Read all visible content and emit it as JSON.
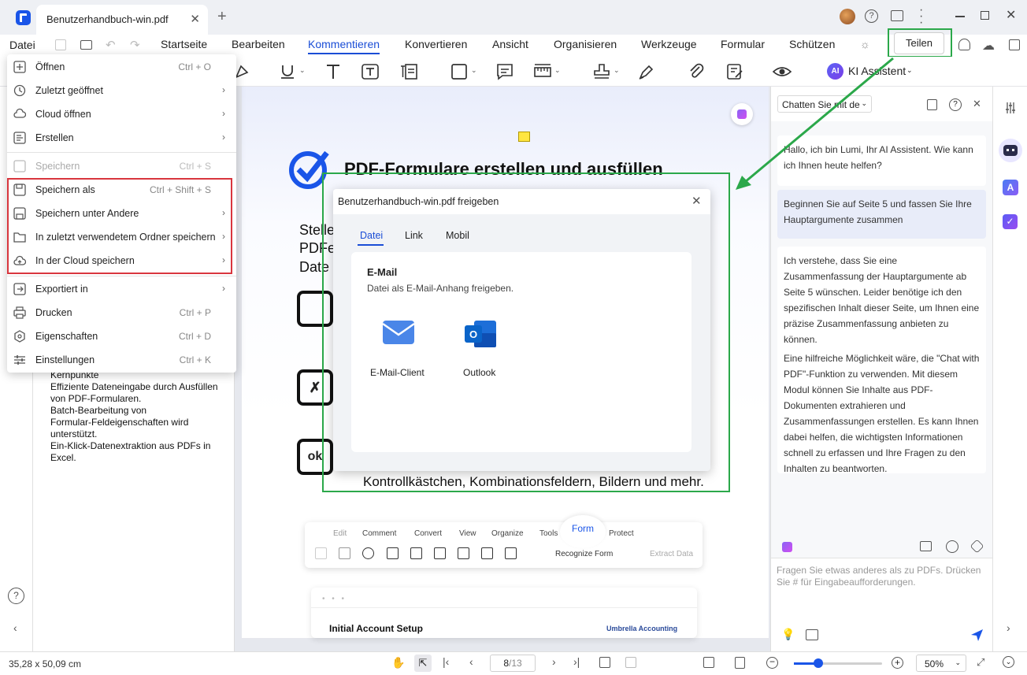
{
  "window": {
    "tab_title": "Benutzerhandbuch-win.pdf",
    "tab_close": "✕",
    "new_tab": "+"
  },
  "menubar": {
    "datei": "Datei",
    "items": [
      "Startseite",
      "Bearbeiten",
      "Kommentieren",
      "Konvertieren",
      "Ansicht",
      "Organisieren",
      "Werkzeuge",
      "Formular",
      "Schützen"
    ],
    "active": "Kommentieren",
    "share_button": "Teilen"
  },
  "toolbar": {
    "ki_badge": "AI",
    "ki_label": "KI Assistent"
  },
  "file_menu": {
    "items": [
      {
        "label": "Öffnen",
        "shortcut": "Ctrl + O",
        "icon": "open-icon"
      },
      {
        "label": "Zuletzt geöffnet",
        "arrow": "›",
        "icon": "recent-icon"
      },
      {
        "label": "Cloud öffnen",
        "arrow": "›",
        "icon": "cloud-icon"
      },
      {
        "label": "Erstellen",
        "arrow": "›",
        "icon": "create-icon"
      },
      {
        "label": "Speichern",
        "shortcut": "Ctrl + S",
        "icon": "save-icon",
        "disabled": true
      },
      {
        "label": "Speichern als",
        "shortcut": "Ctrl + Shift + S",
        "icon": "save-as-icon"
      },
      {
        "label": "Speichern unter Andere",
        "arrow": "›",
        "icon": "save-other-icon"
      },
      {
        "label": "In zuletzt verwendetem Ordner speichern",
        "arrow": "›",
        "icon": "folder-icon"
      },
      {
        "label": "In der Cloud speichern",
        "arrow": "›",
        "icon": "cloud-save-icon"
      },
      {
        "label": "Exportiert in",
        "arrow": "›",
        "icon": "export-icon"
      },
      {
        "label": "Drucken",
        "shortcut": "Ctrl + P",
        "icon": "print-icon"
      },
      {
        "label": "Eigenschaften",
        "shortcut": "Ctrl + D",
        "icon": "properties-icon"
      },
      {
        "label": "Einstellungen",
        "shortcut": "Ctrl + K",
        "icon": "settings-icon"
      }
    ]
  },
  "left_panel": {
    "lines": [
      "Kernpunkte",
      "Effiziente Dateneingabe durch Ausfüllen",
      "von PDF-Formularen.",
      "Batch-Bearbeitung von",
      "Formular-Feldeigenschaften wird",
      "unterstützt.",
      "Ein-Klick-Datenextraktion aus PDFs in",
      "Excel."
    ]
  },
  "page": {
    "heading": "PDF-Formulare erstellen und ausfüllen",
    "side_text": [
      "Stelle",
      "PDFe",
      "Date"
    ],
    "bottom_line": "Kontrollkästchen, Kombinationsfeldern, Bildern und mehr.",
    "mini_toolbar": {
      "tabs": [
        "Edit",
        "Comment",
        "Convert",
        "View",
        "Organize",
        "Tools",
        "Form",
        "Protect"
      ],
      "active": "Form",
      "recognize": "Recognize Form",
      "extract": "Extract Data"
    },
    "card": {
      "title": "Initial Account Setup",
      "brand": "Umbrella Accounting"
    }
  },
  "share_dialog": {
    "title": "Benutzerhandbuch-win.pdf freigeben",
    "tabs": [
      "Datei",
      "Link",
      "Mobil"
    ],
    "active_tab": "Datei",
    "section_title": "E-Mail",
    "section_desc": "Datei als E-Mail-Anhang freigeben.",
    "options": [
      {
        "label": "E-Mail-Client",
        "icon": "mail-icon"
      },
      {
        "label": "Outlook",
        "icon": "outlook-icon"
      }
    ]
  },
  "chat": {
    "selector": "Chatten Sie mit de",
    "messages": [
      {
        "role": "assistant",
        "text": "Hallo, ich bin Lumi, Ihr AI Assistent. Wie kann ich Ihnen heute helfen?"
      },
      {
        "role": "user",
        "text": "Beginnen Sie auf Seite 5 und fassen Sie Ihre Hauptargumente zusammen"
      },
      {
        "role": "assistant",
        "text": "Ich verstehe, dass Sie eine Zusammenfassung der Hauptargumente ab Seite 5 wünschen. Leider benötige ich den spezifischen Inhalt dieser Seite, um Ihnen eine präzise Zusammenfassung anbieten zu können.",
        "text2": "Eine hilfreiche Möglichkeit wäre, die \"Chat with PDF\"-Funktion zu verwenden. Mit diesem Modul können Sie Inhalte aus PDF-Dokumenten extrahieren und Zusammenfassungen erstellen. Es kann Ihnen dabei helfen, die wichtigsten Informationen schnell zu erfassen und Ihre Fragen zu den Inhalten zu beantworten."
      }
    ],
    "input_placeholder": "Fragen Sie etwas anderes als zu PDFs. Drücken Sie # für Eingabeaufforderungen."
  },
  "status": {
    "dimensions": "35,28 x 50,09 cm",
    "page_current": "8",
    "page_total": "/13",
    "zoom": "50%"
  },
  "colors": {
    "accent": "#1a4dd6",
    "highlight_green": "#2ba84a",
    "highlight_red": "#d9363e"
  }
}
